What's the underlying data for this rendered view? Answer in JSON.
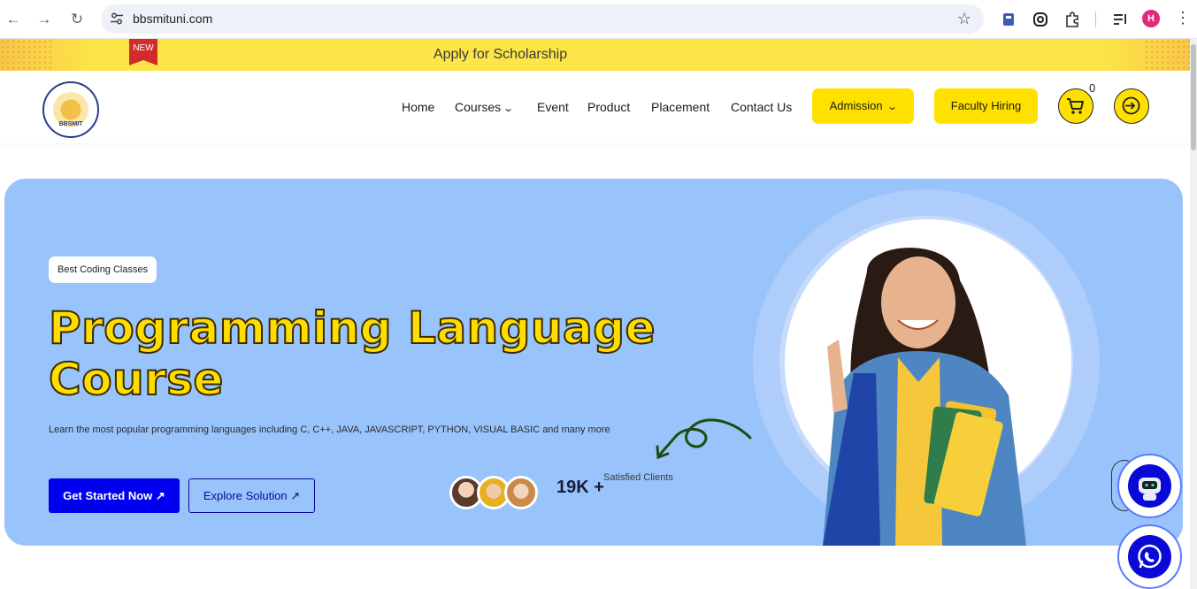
{
  "browser": {
    "url": "bbsmituni.com",
    "profile_initial": "H"
  },
  "banner": {
    "badge": "NEW",
    "message": "Apply for Scholarship"
  },
  "header": {
    "logo_text": "BBSMIT",
    "nav": [
      "Home",
      "Courses",
      "Event",
      "Product",
      "Placement",
      "Contact Us"
    ],
    "admission_label": "Admission",
    "faculty_label": "Faculty Hiring",
    "cart_count": "0"
  },
  "hero": {
    "tag": "Best Coding Classes",
    "title_line1": "Programming Language",
    "title_line2": "Course",
    "description": "Learn the most popular programming languages including C, C++, JAVA, JAVASCRIPT, PYTHON, VISUAL BASIC and many more",
    "primary_button": "Get Started Now",
    "secondary_button": "Explore Solution",
    "stat_value": "19K +",
    "stat_label": "Satisfied Clients"
  },
  "colors": {
    "accent_yellow": "#ffe100",
    "hero_bg": "#99c3fb",
    "primary_blue": "#0000ee"
  }
}
